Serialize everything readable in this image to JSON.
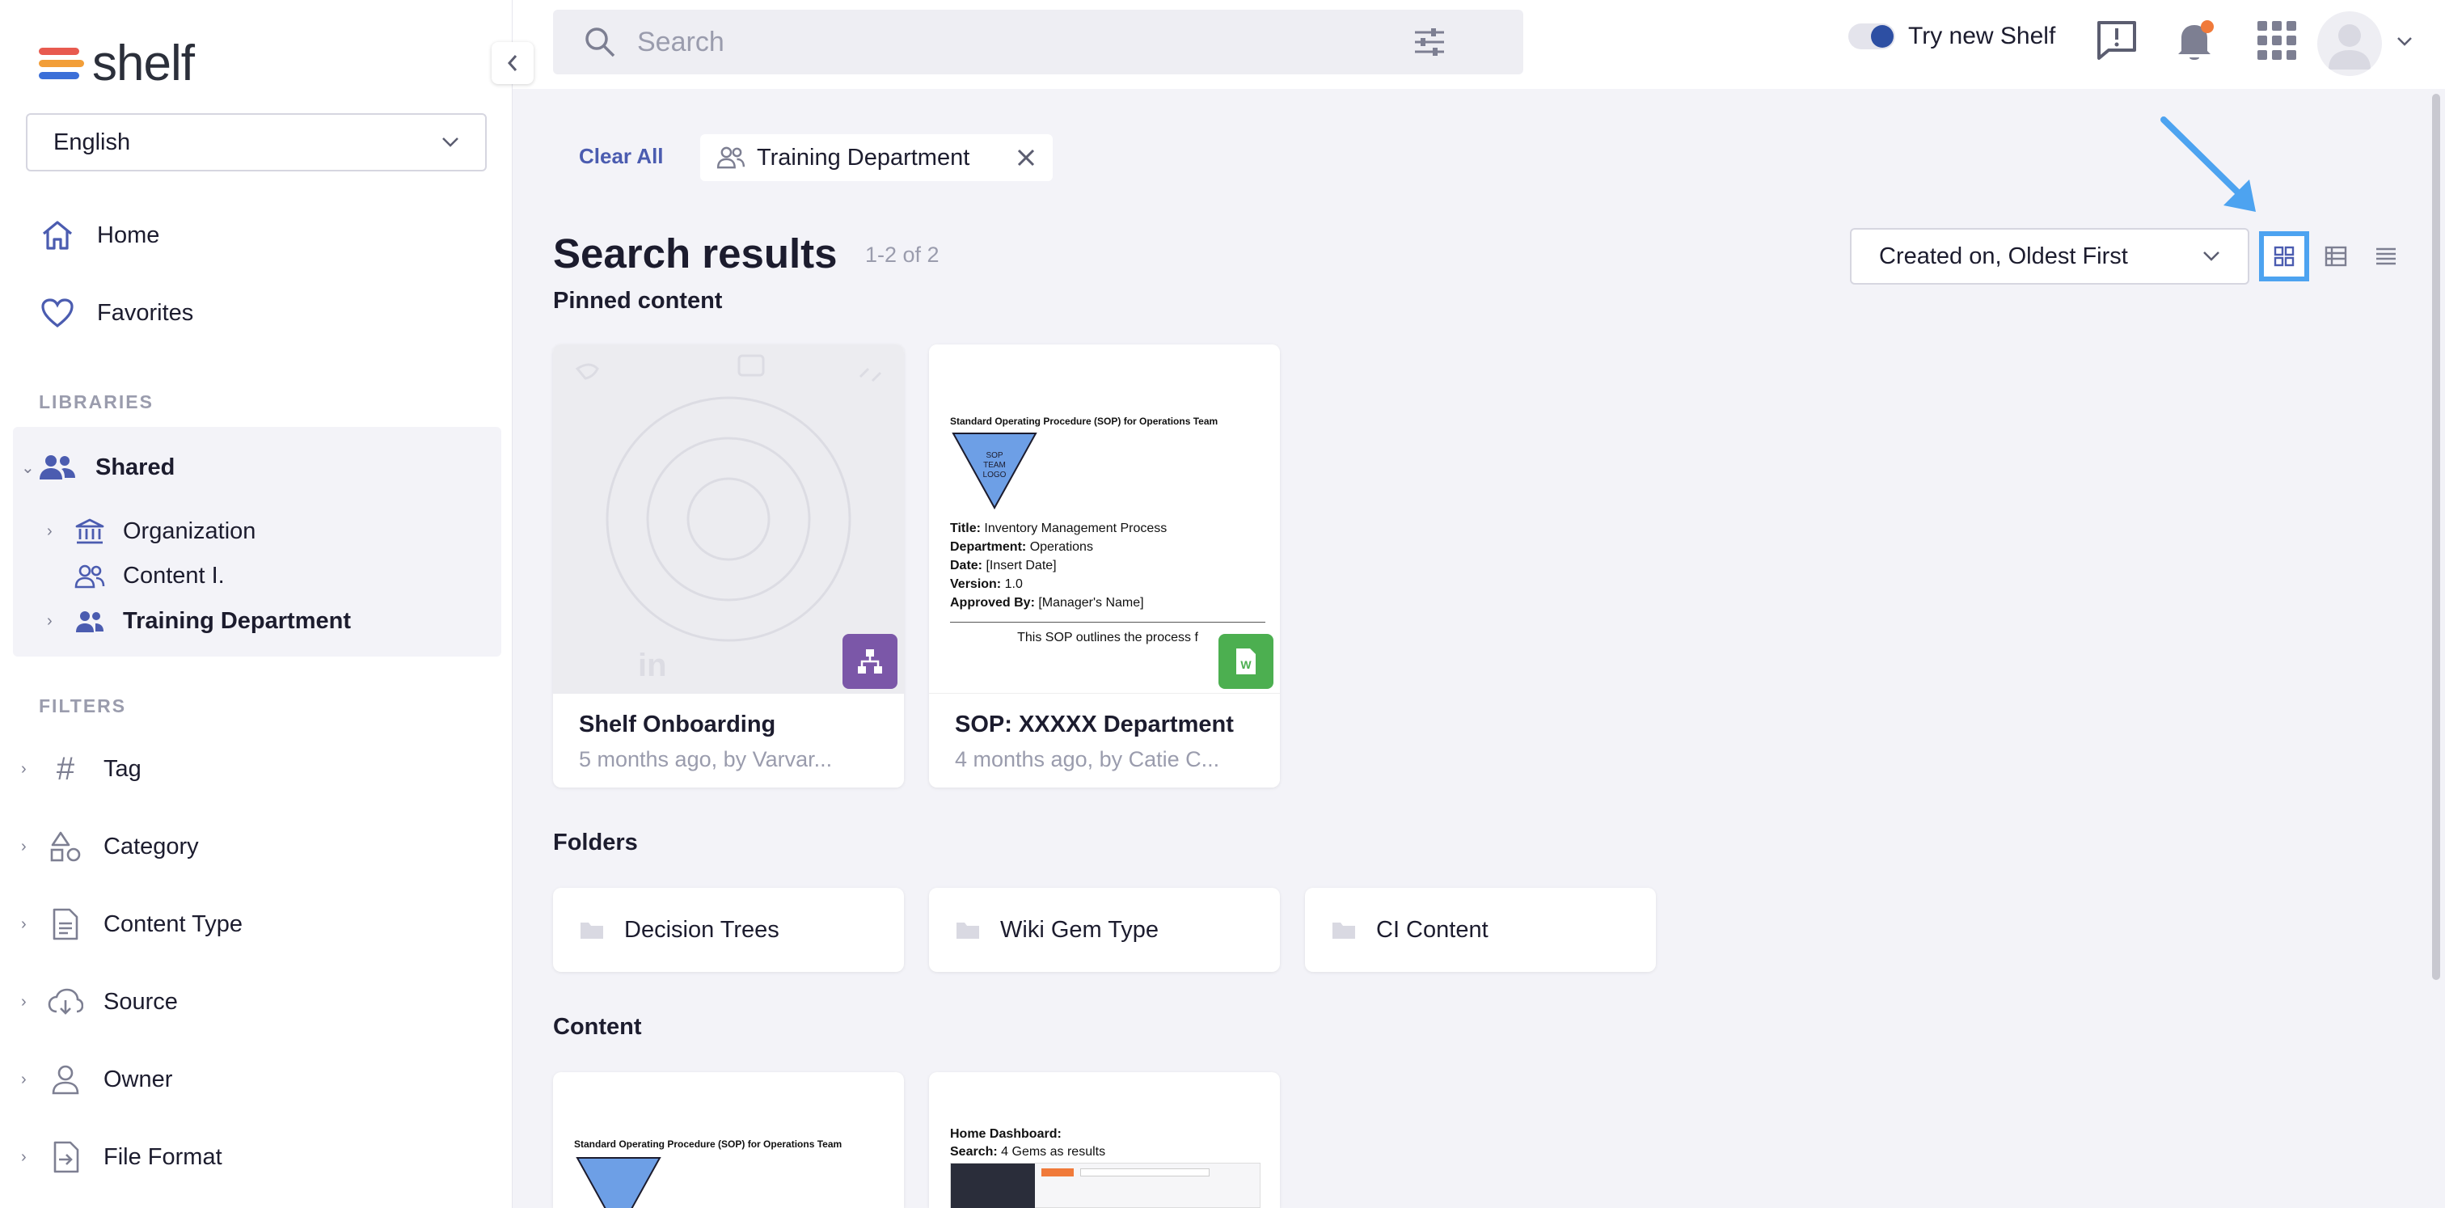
{
  "app": {
    "logo_text": "shelf"
  },
  "sidebar": {
    "language": "English",
    "nav": [
      {
        "label": "Home"
      },
      {
        "label": "Favorites"
      }
    ],
    "libraries_label": "LIBRARIES",
    "shared_label": "Shared",
    "tree": [
      {
        "label": "Organization"
      },
      {
        "label": "Content I."
      },
      {
        "label": "Training Department"
      }
    ],
    "filters_label": "FILTERS",
    "filters": [
      {
        "label": "Tag"
      },
      {
        "label": "Category"
      },
      {
        "label": "Content Type"
      },
      {
        "label": "Source"
      },
      {
        "label": "Owner"
      },
      {
        "label": "File Format"
      }
    ]
  },
  "topbar": {
    "search_placeholder": "Search",
    "try_new_label": "Try new Shelf"
  },
  "filters_bar": {
    "clear_all": "Clear All",
    "chip_label": "Training Department"
  },
  "results": {
    "title": "Search results",
    "count": "1-2 of 2",
    "sort_value": "Created on, Oldest First",
    "pinned_label": "Pinned content",
    "pinned": [
      {
        "name": "Shelf Onboarding",
        "meta": "5 months ago, by Varvar..."
      },
      {
        "name": "SOP: XXXXX Department",
        "meta": "4 months ago, by Catie C..."
      }
    ],
    "sop_preview": {
      "doc_title": "Standard Operating Procedure (SOP) for Operations Team",
      "logo_text": "SOP TEAM LOGO",
      "fields": [
        {
          "k": "Title:",
          "v": "Inventory Management Process"
        },
        {
          "k": "Department:",
          "v": "Operations"
        },
        {
          "k": "Date:",
          "v": "[Insert Date]"
        },
        {
          "k": "Version:",
          "v": "1.0"
        },
        {
          "k": "Approved By:",
          "v": "[Manager's Name]"
        }
      ],
      "body_snippet": "This SOP outlines the process f"
    },
    "folders_label": "Folders",
    "folders": [
      {
        "label": "Decision Trees"
      },
      {
        "label": "Wiki Gem Type"
      },
      {
        "label": "CI Content"
      }
    ],
    "content_label": "Content",
    "content_previews": [
      {
        "doc_title": "Standard Operating Procedure (SOP) for Operations Team"
      },
      {
        "line1_k": "Home Dashboard:",
        "line2_k": "Search:",
        "line2_v": "4 Gems as results"
      }
    ]
  },
  "colors": {
    "accent": "#4b5cb0",
    "badge_purple": "#7b57a8",
    "badge_green": "#4caf50",
    "highlight_blue": "#4da3f0",
    "logo_red": "#e85a4f",
    "logo_orange": "#f29e38",
    "logo_blue": "#3b6fd8"
  }
}
